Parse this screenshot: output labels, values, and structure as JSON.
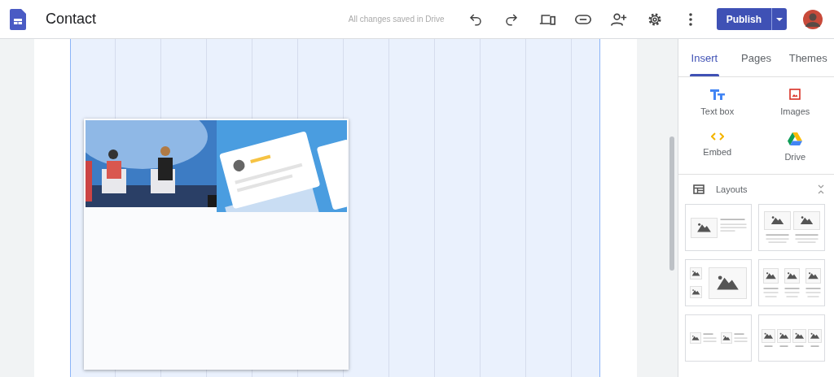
{
  "app": {
    "title": "Contact",
    "save_status": "All changes saved in Drive",
    "publish_button": "Publish"
  },
  "tabs": [
    {
      "label": "Insert",
      "selected": true
    },
    {
      "label": "Pages",
      "selected": false
    },
    {
      "label": "Themes",
      "selected": false
    }
  ],
  "insert_items": [
    {
      "kind": "textbox",
      "label": "Text box"
    },
    {
      "kind": "images",
      "label": "Images"
    },
    {
      "kind": "embed",
      "label": "Embed"
    },
    {
      "kind": "drive",
      "label": "Drive"
    }
  ],
  "layouts": {
    "title": "Layouts",
    "items": [
      {
        "kind": "image-text"
      },
      {
        "kind": "two-images"
      },
      {
        "kind": "stacked-images"
      },
      {
        "kind": "three-columns"
      },
      {
        "kind": "two-image-text"
      },
      {
        "kind": "four-columns"
      }
    ]
  }
}
